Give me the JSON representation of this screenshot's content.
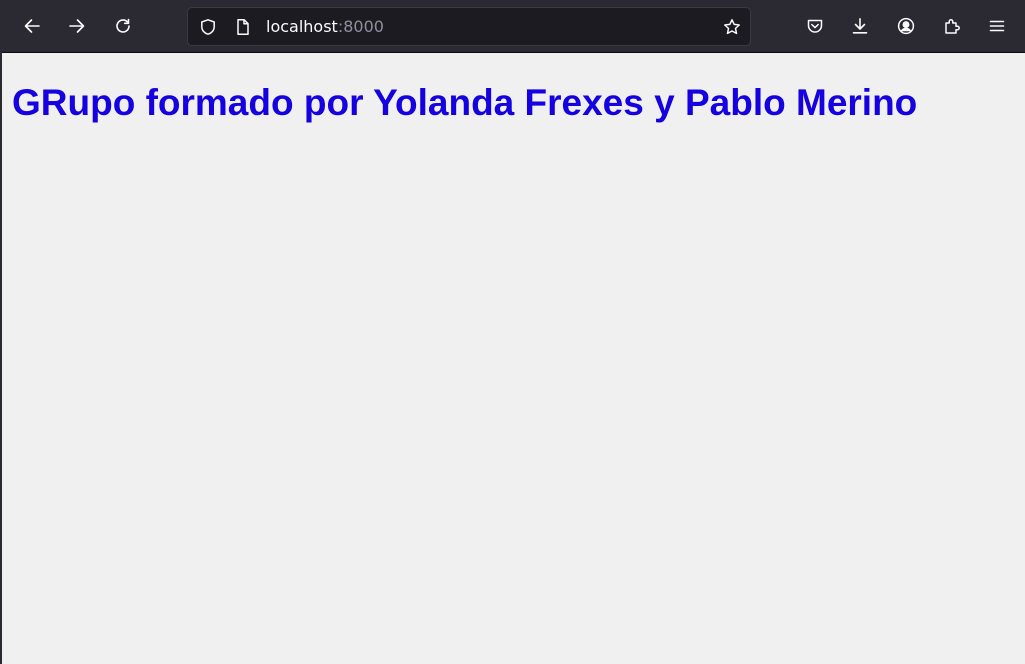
{
  "browser": {
    "url_host": "localhost",
    "url_port": ":8000",
    "icons": {
      "back": "arrow-left",
      "forward": "arrow-right",
      "reload": "reload",
      "tracking_protection": "shield",
      "page_info": "page",
      "bookmark": "star",
      "pocket": "pocket",
      "downloads": "download",
      "account": "account",
      "extensions": "puzzle",
      "menu": "hamburger"
    },
    "colors": {
      "toolbar": "#2b2a33",
      "urlbar": "#1c1b22",
      "icon": "#fbfbfe"
    }
  },
  "page": {
    "heading": "GRupo formado por Yolanda Frexes y Pablo Merino",
    "heading_color": "#1400e0",
    "background": "#f0f0f0"
  }
}
